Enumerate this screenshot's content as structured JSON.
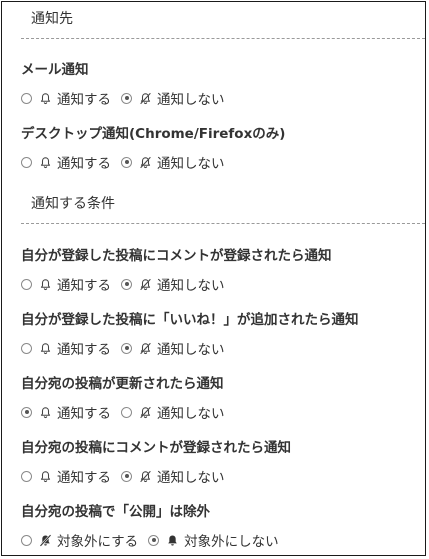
{
  "sections": {
    "destination": {
      "title": "通知先"
    },
    "conditions": {
      "title": "通知する条件"
    }
  },
  "groups": [
    {
      "title": "メール通知",
      "options": [
        {
          "label": "通知する",
          "icon": "bell-icon",
          "checked": false
        },
        {
          "label": "通知しない",
          "icon": "bell-slash-icon",
          "checked": true
        }
      ]
    },
    {
      "title": "デスクトップ通知(Chrome/Firefoxのみ)",
      "options": [
        {
          "label": "通知する",
          "icon": "bell-icon",
          "checked": false
        },
        {
          "label": "通知しない",
          "icon": "bell-slash-icon",
          "checked": true
        }
      ]
    },
    {
      "title": "自分が登録した投稿にコメントが登録されたら通知",
      "options": [
        {
          "label": "通知する",
          "icon": "bell-icon",
          "checked": false
        },
        {
          "label": "通知しない",
          "icon": "bell-slash-icon",
          "checked": true
        }
      ]
    },
    {
      "title": "自分が登録した投稿に「いいね！」が追加されたら通知",
      "options": [
        {
          "label": "通知する",
          "icon": "bell-icon",
          "checked": false
        },
        {
          "label": "通知しない",
          "icon": "bell-slash-icon",
          "checked": true
        }
      ]
    },
    {
      "title": "自分宛の投稿が更新されたら通知",
      "options": [
        {
          "label": "通知する",
          "icon": "bell-icon",
          "checked": true
        },
        {
          "label": "通知しない",
          "icon": "bell-slash-icon",
          "checked": false
        }
      ]
    },
    {
      "title": "自分宛の投稿にコメントが登録されたら通知",
      "options": [
        {
          "label": "通知する",
          "icon": "bell-icon",
          "checked": false
        },
        {
          "label": "通知しない",
          "icon": "bell-slash-icon",
          "checked": true
        }
      ]
    },
    {
      "title": "自分宛の投稿で「公開」は除外",
      "options": [
        {
          "label": "対象外にする",
          "icon": "bell-slash-solid-icon",
          "checked": false
        },
        {
          "label": "対象外にしない",
          "icon": "bell-solid-icon",
          "checked": true
        }
      ]
    }
  ]
}
